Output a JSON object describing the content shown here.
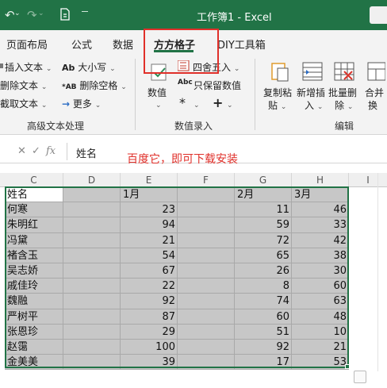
{
  "title_bar": {
    "title": "工作簿1  -  Excel"
  },
  "tabs": [
    {
      "label": "页面布局",
      "active": false
    },
    {
      "label": "公式",
      "active": false
    },
    {
      "label": "数据",
      "active": false
    },
    {
      "label": "方方格子",
      "active": true
    },
    {
      "label": "DIY工具箱",
      "active": false
    }
  ],
  "ribbon": {
    "advanced_text": {
      "insert_text": "插入文本",
      "delete_text": "删除文本",
      "cut_text": "截取文本",
      "case": "大小写",
      "remove_spaces": "删除空格",
      "more": "更多",
      "group_label": "高级文本处理"
    },
    "number_entry": {
      "value": "数值",
      "round": "四舍五入",
      "keep_numbers": "只保留数值",
      "group_label": "数值录入"
    },
    "edit": {
      "copy_paste": "复制粘",
      "copy_paste2": "贴",
      "new_insert": "新增插",
      "new_insert2": "入",
      "batch_delete": "批量删",
      "batch_delete2": "除",
      "merge": "合并",
      "merge2": "换",
      "group_label": "编辑"
    }
  },
  "formula_bar": {
    "value": "姓名"
  },
  "annotation": "百度它，即可下载安装",
  "columns": [
    "C",
    "D",
    "E",
    "F",
    "G",
    "H",
    "I"
  ],
  "sheet": {
    "header": [
      "姓名",
      "",
      "1月",
      "",
      "2月",
      "3月"
    ],
    "rows": [
      [
        "何寒",
        "",
        "23",
        "",
        "11",
        "46"
      ],
      [
        "朱明红",
        "",
        "94",
        "",
        "59",
        "33"
      ],
      [
        "冯黛",
        "",
        "21",
        "",
        "72",
        "42"
      ],
      [
        "褚含玉",
        "",
        "54",
        "",
        "65",
        "38"
      ],
      [
        "吴志娇",
        "",
        "67",
        "",
        "26",
        "30"
      ],
      [
        "戚佳玲",
        "",
        "22",
        "",
        "8",
        "60"
      ],
      [
        "魏融",
        "",
        "92",
        "",
        "74",
        "63"
      ],
      [
        "严树平",
        "",
        "87",
        "",
        "60",
        "48"
      ],
      [
        "张恩珍",
        "",
        "29",
        "",
        "51",
        "10"
      ],
      [
        "赵霭",
        "",
        "100",
        "",
        "92",
        "21"
      ],
      [
        "金美美",
        "",
        "39",
        "",
        "17",
        "53"
      ]
    ]
  },
  "colors": {
    "excel_green": "#217346",
    "highlight_red": "#e0302a",
    "cell_gray": "#c7c7c7"
  }
}
